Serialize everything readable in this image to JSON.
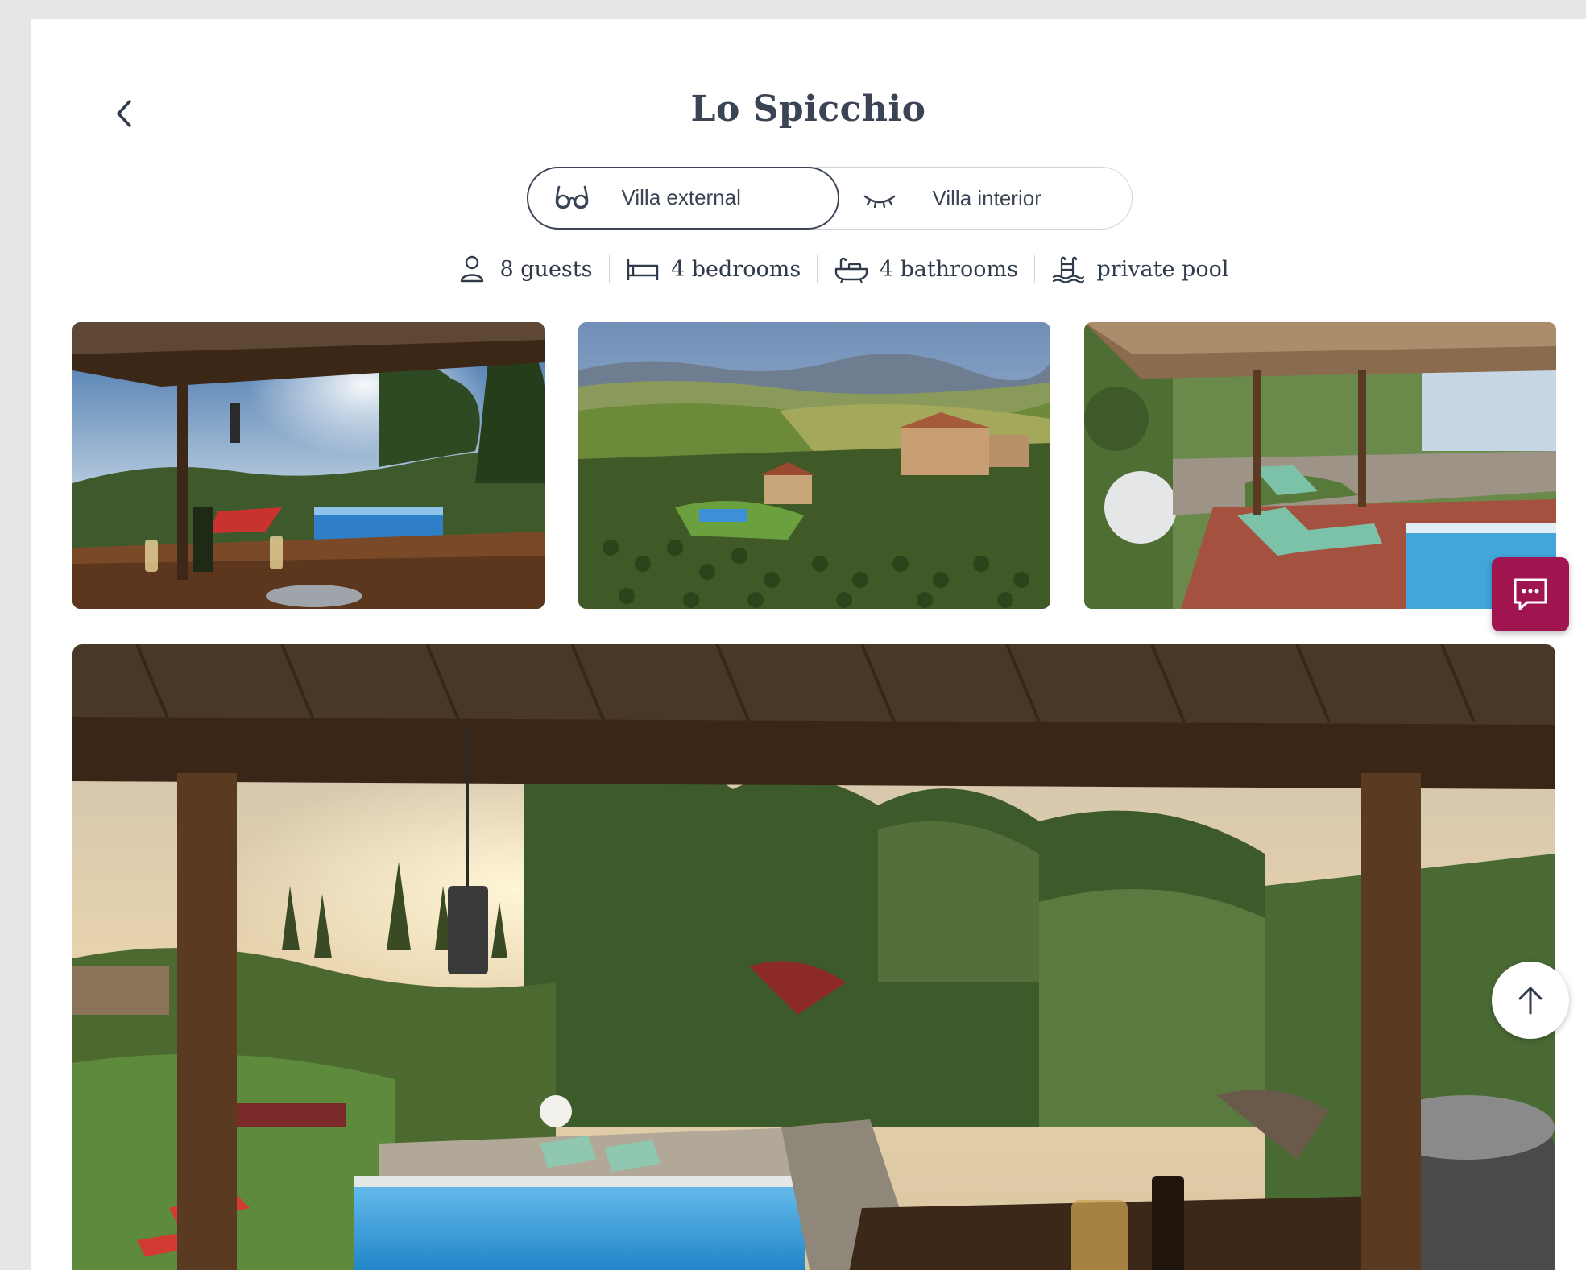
{
  "villa": {
    "title": "Lo Spicchio"
  },
  "toggle": {
    "options": [
      {
        "label": "Villa external",
        "icon": "glasses-icon",
        "active": true
      },
      {
        "label": "Villa interior",
        "icon": "closed-eye-icon",
        "active": false
      }
    ]
  },
  "features": [
    {
      "icon": "person-icon",
      "label": "8 guests"
    },
    {
      "icon": "bed-icon",
      "label": "4 bedrooms"
    },
    {
      "icon": "bathtub-icon",
      "label": "4 bathrooms"
    },
    {
      "icon": "pool-ladder-icon",
      "label": "private pool"
    }
  ],
  "gallery": {
    "thumbnails": [
      {
        "subject": "pergola-dining-pool-sunset"
      },
      {
        "subject": "aerial-villa-vineyards"
      },
      {
        "subject": "pergola-loungers-pool"
      }
    ],
    "hero": {
      "subject": "pergola-view-pool-garden-sunset"
    }
  },
  "colors": {
    "accent": "#a0144f",
    "text": "#2f3a4b",
    "background": "#ffffff",
    "frame": "#e6e6e6"
  },
  "floating": {
    "chat_icon": "chat-bubble-icon",
    "top_icon": "arrow-up-icon"
  }
}
